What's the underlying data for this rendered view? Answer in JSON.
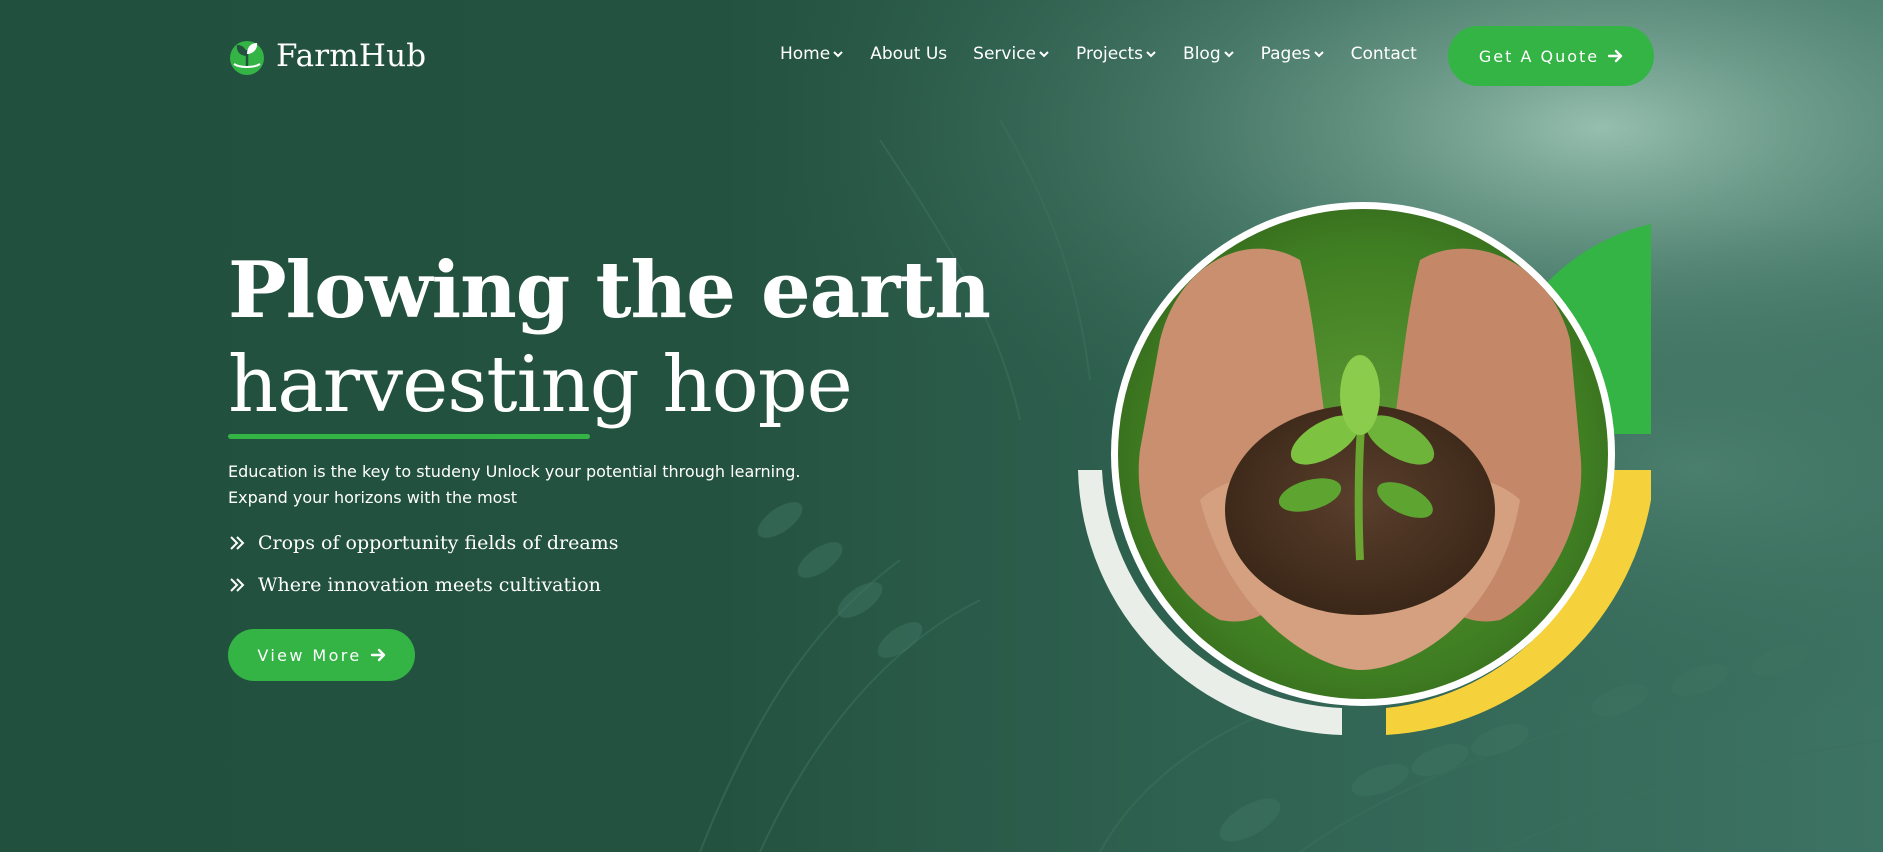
{
  "brand": {
    "name": "FarmHub",
    "logo_icon": "leaf-sprout-icon"
  },
  "nav": {
    "items": [
      {
        "label": "Home",
        "has_dropdown": true
      },
      {
        "label": "About Us",
        "has_dropdown": false
      },
      {
        "label": "Service",
        "has_dropdown": true
      },
      {
        "label": "Projects",
        "has_dropdown": true
      },
      {
        "label": "Blog",
        "has_dropdown": true
      },
      {
        "label": "Pages",
        "has_dropdown": true
      },
      {
        "label": "Contact",
        "has_dropdown": false
      }
    ],
    "cta_label": "Get A Quote"
  },
  "hero": {
    "headline_line1": "Plowing the earth",
    "headline_line2": "harvesting hope",
    "description_line1": "Education is the key to studeny Unlock your potential through learning.",
    "description_line2": "Expand your horizons with the most",
    "features": [
      "Crops of opportunity fields of dreams",
      "Where innovation meets cultivation"
    ],
    "button_label": "View More",
    "image_subject": "hands holding soil with green seedling"
  },
  "colors": {
    "background": "#24503f",
    "accent_green": "#33b445",
    "accent_yellow": "#f5d23b",
    "light_arc": "#e9eee9",
    "text": "#ffffff"
  }
}
